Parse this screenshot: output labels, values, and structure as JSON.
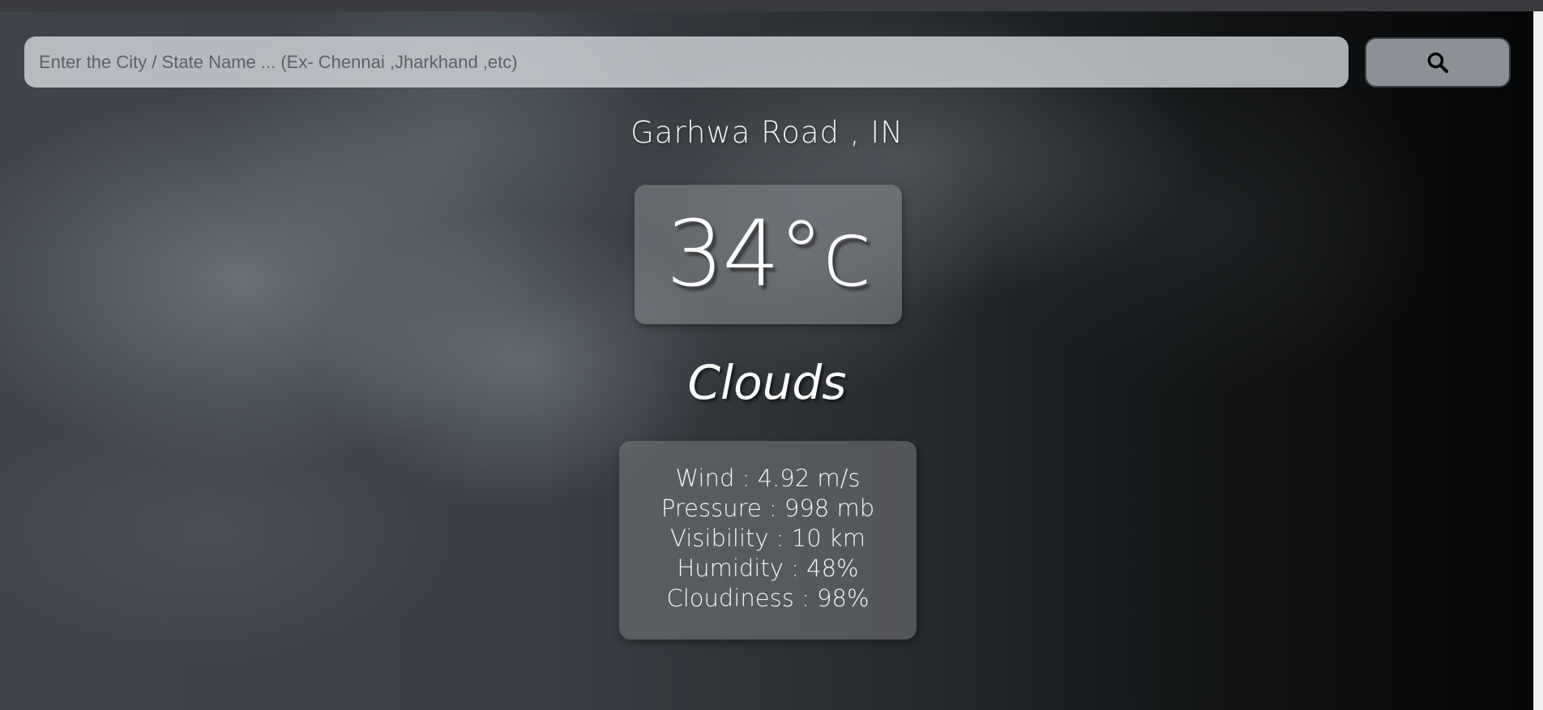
{
  "search": {
    "placeholder": "Enter the City / State Name ... (Ex- Chennai ,Jharkhand ,etc)",
    "value": "",
    "button_icon": "search-icon"
  },
  "weather": {
    "location": "Garhwa Road , IN",
    "temperature": "34°c",
    "condition": "Clouds",
    "details": [
      "Wind : 4.92 m/s",
      "Pressure : 998 mb",
      "Visibility : 10 km",
      "Humidity : 48%",
      "Cloudiness : 98%"
    ]
  },
  "colors": {
    "text": "#ffffff",
    "search_field": "#d7dce1",
    "search_button": "#8c9097"
  }
}
